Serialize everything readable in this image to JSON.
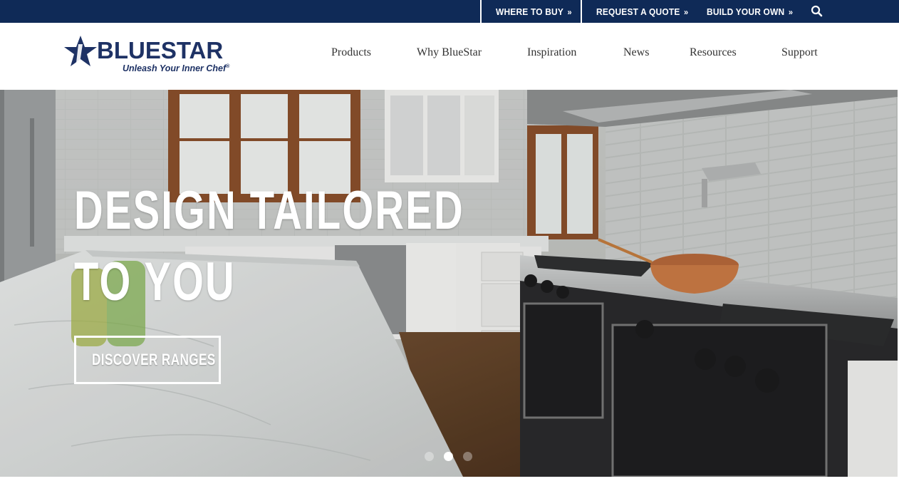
{
  "utility_nav": {
    "where_to_buy": "WHERE TO BUY",
    "request_quote": "REQUEST A QUOTE",
    "build_your_own": "BUILD YOUR OWN",
    "chevron": "»",
    "search_icon": "search-icon"
  },
  "brand": {
    "name": "BLUESTAR",
    "tagline": "Unleash Your Inner Chef",
    "registered_mark": "®",
    "color": "#1e3265"
  },
  "main_nav": [
    {
      "label": "Products"
    },
    {
      "label": "Why BlueStar"
    },
    {
      "label": "Inspiration"
    },
    {
      "label": "News"
    },
    {
      "label": "Resources"
    },
    {
      "label": "Support"
    }
  ],
  "hero": {
    "headline_line1": "DESIGN TAILORED",
    "headline_line2": "TO YOU",
    "cta_label": "DISCOVER RANGES",
    "slides_total": 3,
    "active_slide": 2
  },
  "colors": {
    "utility_bar": "#0f2a57",
    "brand_navy": "#1e3265",
    "nav_text": "#333333"
  }
}
